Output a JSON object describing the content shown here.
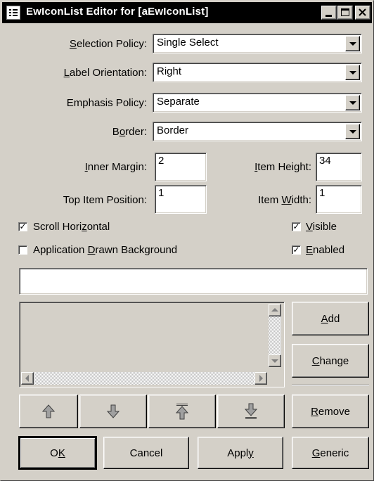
{
  "window": {
    "title": "EwIconList Editor for [aEwIconList]",
    "icons": {
      "app": "app-icon",
      "minimize": "minimize-icon",
      "maximize": "maximize-icon",
      "close": "close-icon"
    }
  },
  "form": {
    "selection_policy": {
      "label_pre": "",
      "label_u": "S",
      "label_post": "election Policy:",
      "value": "Single Select"
    },
    "label_orientation": {
      "label_pre": "",
      "label_u": "L",
      "label_post": "abel Orientation:",
      "value": "Right"
    },
    "emphasis_policy": {
      "label": "Emphasis Policy:",
      "value": "Separate"
    },
    "border": {
      "label_pre": "B",
      "label_u": "o",
      "label_post": "rder:",
      "value": "Border"
    },
    "inner_margin": {
      "label_pre": "",
      "label_u": "I",
      "label_post": "nner Margin:",
      "value": "2"
    },
    "item_height": {
      "label_pre": "",
      "label_u": "I",
      "label_post": "tem Height:",
      "value": "34"
    },
    "top_item_position": {
      "label": "Top Item Position:",
      "value": "1"
    },
    "item_width": {
      "label_pre": "Item ",
      "label_u": "W",
      "label_post": "idth:",
      "value": "1"
    }
  },
  "checks": {
    "scroll_horizontal": {
      "label_pre": "Scroll Hori",
      "label_u": "z",
      "label_post": "ontal",
      "checked": true
    },
    "visible": {
      "label_pre": "",
      "label_u": "V",
      "label_post": "isible",
      "checked": true
    },
    "app_drawn_bg": {
      "label_pre": "Application ",
      "label_u": "D",
      "label_post": "rawn Background",
      "checked": false
    },
    "enabled": {
      "label_pre": "",
      "label_u": "E",
      "label_post": "nabled",
      "checked": true
    }
  },
  "item_entry": {
    "value": ""
  },
  "list_buttons": {
    "add": {
      "pre": "",
      "u": "A",
      "post": "dd"
    },
    "change": {
      "pre": "",
      "u": "C",
      "post": "hange"
    },
    "remove": {
      "pre": "",
      "u": "R",
      "post": "emove"
    }
  },
  "move_buttons": [
    "move-up-icon",
    "move-down-icon",
    "move-top-icon",
    "move-bottom-icon"
  ],
  "footer": {
    "ok": {
      "pre": "O",
      "u": "K",
      "post": ""
    },
    "cancel": {
      "label": "Cancel"
    },
    "apply": {
      "pre": "Appl",
      "u": "y",
      "post": ""
    },
    "generic": {
      "pre": "",
      "u": "G",
      "post": "eneric"
    }
  }
}
